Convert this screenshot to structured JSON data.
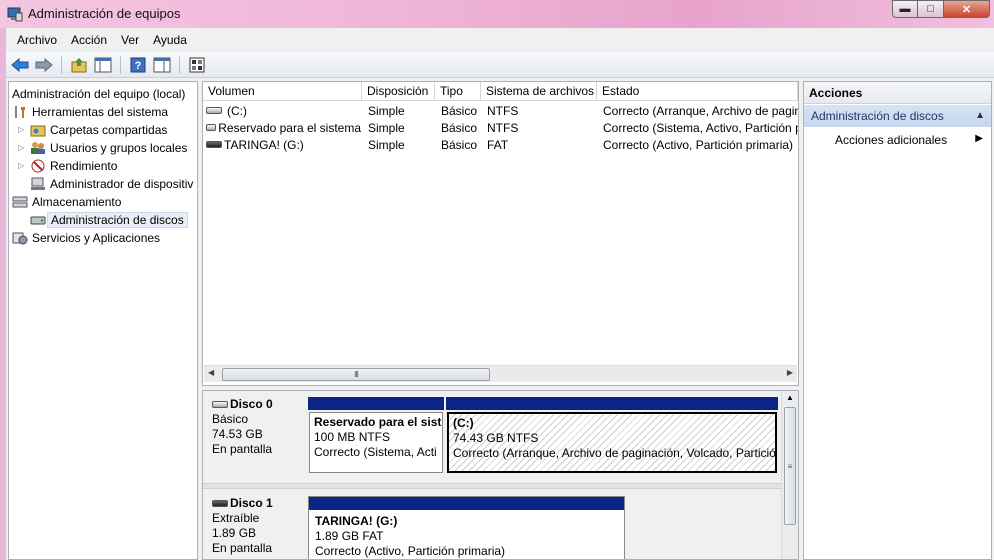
{
  "window": {
    "title": "Administración de equipos"
  },
  "menu": [
    "Archivo",
    "Acción",
    "Ver",
    "Ayuda"
  ],
  "toolbar": {
    "buttons": [
      "back-arrow-icon",
      "forward-arrow-icon",
      "up-folder-icon",
      "show-hide-tree-icon",
      "help-icon",
      "properties-icon",
      "console-icon"
    ]
  },
  "tree": {
    "root": "Administración del equipo (local)",
    "system_tools": "Herramientas del sistema",
    "shared_folders": "Carpetas compartidas",
    "local_users": "Usuarios y grupos locales",
    "performance": "Rendimiento",
    "device_manager": "Administrador de dispositiv",
    "storage": "Almacenamiento",
    "disk_management": "Administración de discos",
    "services": "Servicios y Aplicaciones"
  },
  "volumes": {
    "columns": [
      "Volumen",
      "Disposición",
      "Tipo",
      "Sistema de archivos",
      "Estado"
    ],
    "rows": [
      {
        "name": "(C:)",
        "layout": "Simple",
        "type": "Básico",
        "fs": "NTFS",
        "status": "Correcto (Arranque, Archivo de pagin"
      },
      {
        "name": "Reservado para el sistema",
        "layout": "Simple",
        "type": "Básico",
        "fs": "NTFS",
        "status": "Correcto (Sistema, Activo, Partición p"
      },
      {
        "name": "TARINGA! (G:)",
        "layout": "Simple",
        "type": "Básico",
        "fs": "FAT",
        "status": "Correcto (Activo, Partición primaria)"
      }
    ],
    "scroll_thumb": "III"
  },
  "disks": [
    {
      "name": "Disco 0",
      "kind": "Básico",
      "size": "74.53 GB",
      "state": "En pantalla",
      "partitions": [
        {
          "name": "Reservado para el sist",
          "size": "100 MB NTFS",
          "status": "Correcto (Sistema, Acti"
        },
        {
          "name": "(C:)",
          "size": "74.43 GB NTFS",
          "status": "Correcto (Arranque, Archivo de paginación, Volcado, Partició"
        }
      ]
    },
    {
      "name": "Disco 1",
      "kind": "Extraíble",
      "size": "1.89 GB",
      "state": "En pantalla",
      "partitions": [
        {
          "name": "TARINGA!  (G:)",
          "size": "1.89 GB FAT",
          "status": "Correcto (Activo, Partición primaria)"
        }
      ]
    }
  ],
  "actions": {
    "header": "Acciones",
    "section": "Administración de discos",
    "more": "Acciones adicionales"
  }
}
